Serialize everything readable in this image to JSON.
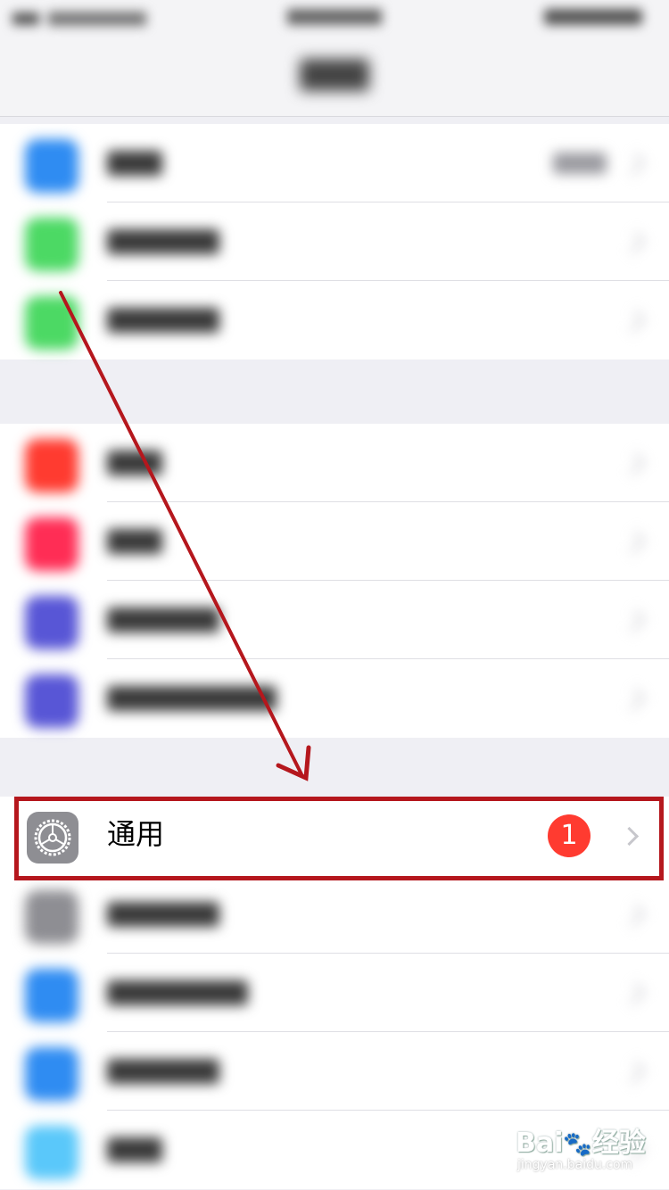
{
  "nav": {
    "title": ""
  },
  "groups": [
    {
      "rows": [
        {
          "icon": "bluetooth-icon",
          "color": "#2f8cf2"
        },
        {
          "icon": "cellular-icon",
          "color": "#4cd964"
        },
        {
          "icon": "hotspot-icon",
          "color": "#4cd964"
        }
      ]
    },
    {
      "rows": [
        {
          "icon": "notifications-icon",
          "color": "#ff3b30"
        },
        {
          "icon": "sounds-icon",
          "color": "#ff2d55"
        },
        {
          "icon": "do-not-disturb-icon",
          "color": "#5856d6"
        },
        {
          "icon": "screen-time-icon",
          "color": "#5856d6"
        }
      ]
    },
    {
      "rows": [
        {
          "icon": "control-center-icon",
          "color": "#8e8e93"
        },
        {
          "icon": "display-brightness-icon",
          "color": "#2f8cf2"
        },
        {
          "icon": "accessibility-icon",
          "color": "#2f8cf2"
        },
        {
          "icon": "wallpaper-icon",
          "color": "#5ac8fa"
        }
      ]
    }
  ],
  "general": {
    "label": "通用",
    "badge": "1",
    "icon": "gear-icon",
    "highlight_color": "#b5171d"
  },
  "watermark": {
    "brand": "Bai",
    "brand_suffix": "经验",
    "url": "jingyan.baidu.com"
  }
}
